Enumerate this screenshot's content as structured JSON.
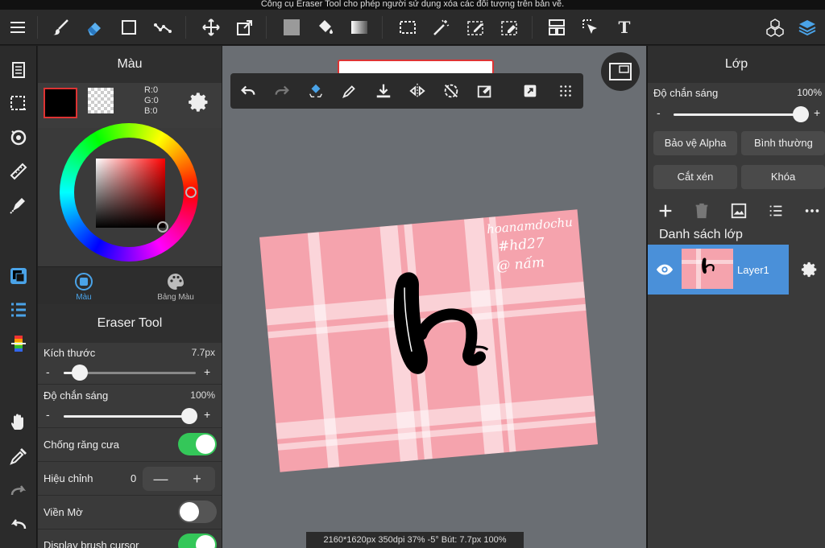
{
  "caption": "Công cụ Eraser Tool cho phép người sử dụng xóa các đối tượng trên bản vẽ.",
  "top_toolbar": {
    "text_tool_label": "T"
  },
  "color_panel": {
    "title": "Màu",
    "rgb": {
      "r": "R:0",
      "g": "G:0",
      "b": "B:0"
    },
    "tabs": [
      {
        "label": "Màu",
        "active": true
      },
      {
        "label": "Bảng Màu",
        "active": false
      }
    ]
  },
  "tool_panel": {
    "title": "Eraser Tool",
    "size": {
      "label": "Kích thước",
      "value": "7.7px",
      "level": 0.12
    },
    "opacity": {
      "label": "Độ chắn sáng",
      "value": "100%",
      "level": 1.0
    },
    "antialias": {
      "label": "Chống răng cưa",
      "on": true
    },
    "correction": {
      "label": "Hiệu chỉnh",
      "value": "0",
      "minus": "—",
      "plus": "+"
    },
    "blur_edge": {
      "label": "Viền Mờ",
      "on": false
    },
    "brush_cursor": {
      "label": "Display brush cursor",
      "on": true
    },
    "minus": "-",
    "plus": "+"
  },
  "canvas": {
    "status": "2160*1620px 350dpi 37% -5° Bút: 7.7px 100%",
    "art_text": [
      "hoanamdochu",
      "#hd27",
      "@ nấm"
    ],
    "art_color": "#f5a3ad"
  },
  "layer_panel": {
    "title": "Lớp",
    "opacity_label": "Độ chắn sáng",
    "opacity_value": "100%",
    "opacity_level": 1.0,
    "minus": "-",
    "plus": "+",
    "alpha_protect": "Bảo vệ Alpha",
    "blend_mode": "Bình thường",
    "clip": "Cắt xén",
    "lock": "Khóa",
    "list_title": "Danh sách lớp",
    "layers": [
      {
        "name": "Layer1",
        "selected": true
      }
    ]
  },
  "colors": {
    "accent_blue": "#4a90d9",
    "toggle_green": "#34c759",
    "panel_bg": "#3a3a3a"
  }
}
